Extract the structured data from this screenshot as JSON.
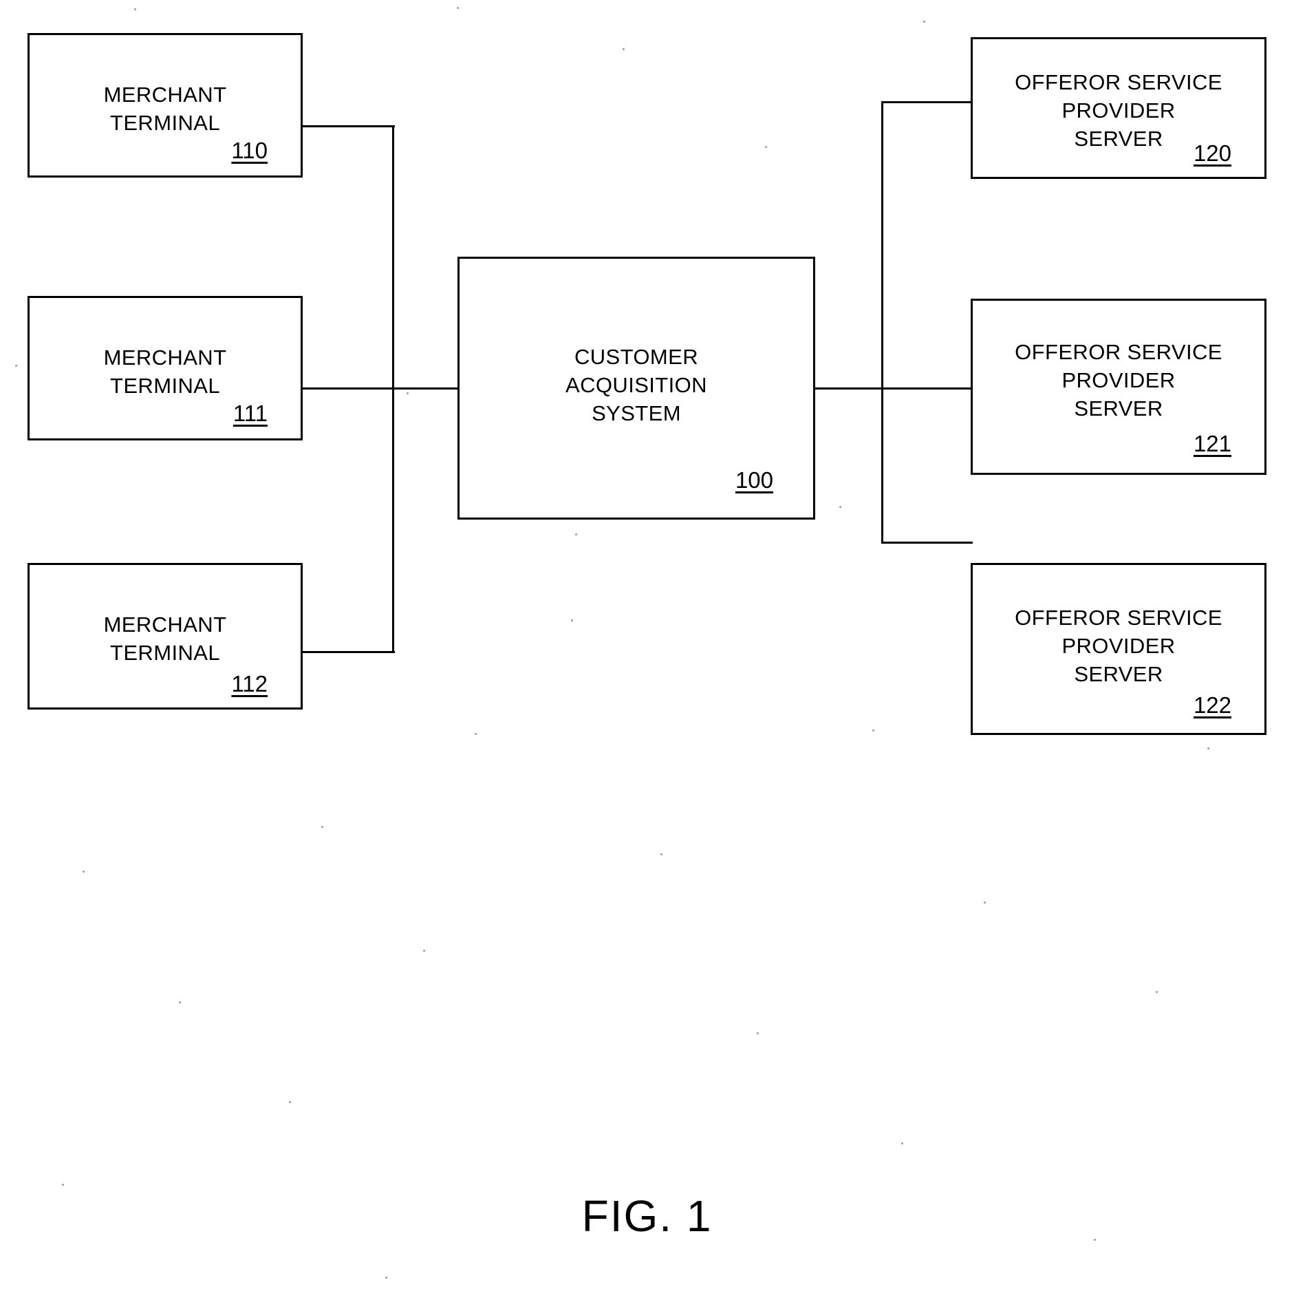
{
  "figure": {
    "caption": "FIG. 1",
    "line_color": "#000000",
    "background_color": "#ffffff"
  },
  "nodes": {
    "merchant_terminal_110": {
      "label": "MERCHANT\nTERMINAL",
      "ref": "110"
    },
    "merchant_terminal_111": {
      "label": "MERCHANT\nTERMINAL",
      "ref": "111"
    },
    "merchant_terminal_112": {
      "label": "MERCHANT\nTERMINAL",
      "ref": "112"
    },
    "customer_acquisition_system_100": {
      "label": "CUSTOMER\nACQUISITION\nSYSTEM",
      "ref": "100"
    },
    "offeror_service_provider_server_120": {
      "label": "OFFEROR SERVICE\nPROVIDER\nSERVER",
      "ref": "120"
    },
    "offeror_service_provider_server_121": {
      "label": "OFFEROR SERVICE\nPROVIDER\nSERVER",
      "ref": "121"
    },
    "offeror_service_provider_server_122": {
      "label": "OFFEROR SERVICE\nPROVIDER\nSERVER",
      "ref": "122"
    }
  }
}
